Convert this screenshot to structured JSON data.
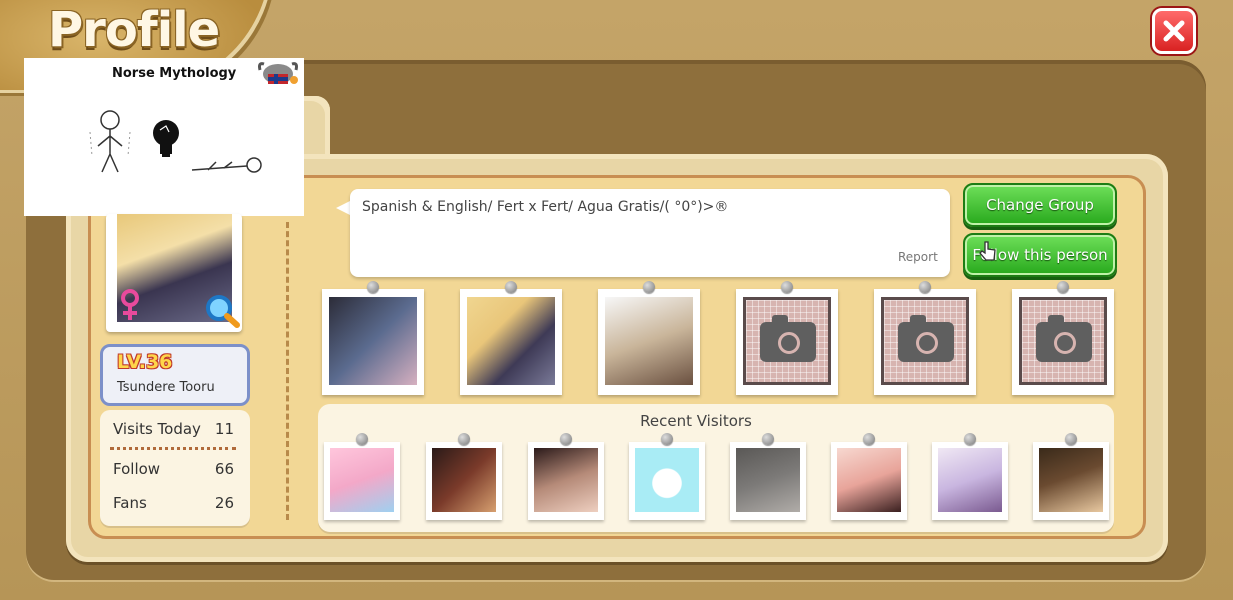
{
  "header": {
    "title": "Profile"
  },
  "ad": {
    "title": "Norse Mythology"
  },
  "profile": {
    "level": "LV.36",
    "username": "Tsundere Tooru",
    "gender": "female"
  },
  "stats": [
    {
      "label": "Visits Today",
      "value": "11"
    },
    {
      "label": "Follow",
      "value": "66"
    },
    {
      "label": "Fans",
      "value": "26"
    }
  ],
  "bio": {
    "text": "Spanish & English/ Fert x Fert/ Agua Gratis/(  °0°)>®",
    "report_label": "Report"
  },
  "actions": {
    "change_group_label": "Change Group",
    "follow_label": "Follow this person"
  },
  "photos": [
    {
      "state": "filled",
      "color": "#5b6b8f"
    },
    {
      "state": "filled",
      "color": "#3e3a56"
    },
    {
      "state": "filled",
      "color": "#c9b59a"
    },
    {
      "state": "empty"
    },
    {
      "state": "empty"
    },
    {
      "state": "empty"
    }
  ],
  "visitors": {
    "heading": "Recent Visitors",
    "items": [
      {
        "color": "#f3a8c8"
      },
      {
        "color": "#7a3a2a"
      },
      {
        "color": "#b58a78"
      },
      {
        "color": "#a9ecf5"
      },
      {
        "color": "#7c7a78"
      },
      {
        "color": "#e8a49a"
      },
      {
        "color": "#c9b6e0"
      },
      {
        "color": "#6a4a30"
      }
    ]
  },
  "colors": {
    "accent_green": "#27a81c",
    "close_red": "#d92222",
    "level_border": "#7c90c9"
  }
}
